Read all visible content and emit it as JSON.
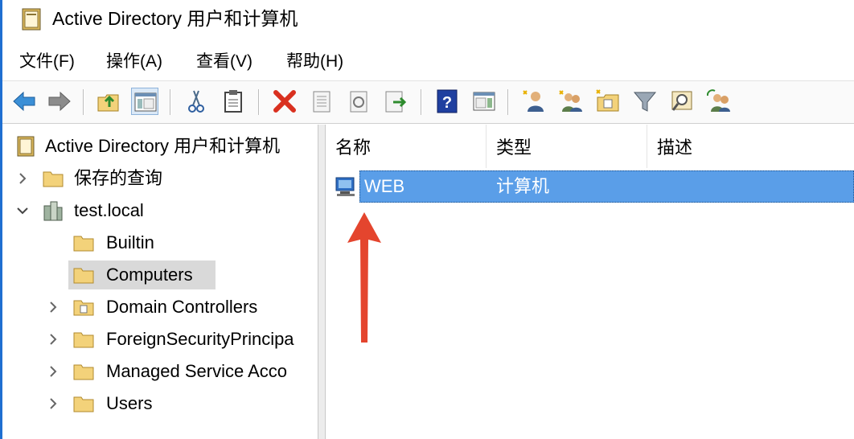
{
  "window": {
    "title": "Active Directory 用户和计算机"
  },
  "menubar": {
    "items": [
      {
        "label": "文件(F)"
      },
      {
        "label": "操作(A)"
      },
      {
        "label": "查看(V)"
      },
      {
        "label": "帮助(H)"
      }
    ]
  },
  "toolbar": {
    "buttons": [
      "back-icon",
      "forward-icon",
      "up-folder-icon",
      "show-hide-tree-icon",
      "cut-icon",
      "paste-icon",
      "delete-icon",
      "properties-icon",
      "refresh-icon",
      "export-list-icon",
      "help-icon",
      "show-hide-action-pane-icon",
      "create-user-icon",
      "create-group-icon",
      "create-ou-icon",
      "filter-icon",
      "find-icon",
      "add-to-group-icon"
    ]
  },
  "tree": {
    "root": {
      "label": "Active Directory 用户和计算机"
    },
    "items": [
      {
        "label": "保存的查询",
        "expanded": false
      },
      {
        "label": "test.local",
        "expanded": true
      },
      {
        "label": "Builtin"
      },
      {
        "label": "Computers",
        "selected": true
      },
      {
        "label": "Domain Controllers"
      },
      {
        "label": "ForeignSecurityPrincipa"
      },
      {
        "label": "Managed Service Acco"
      },
      {
        "label": "Users"
      }
    ]
  },
  "list": {
    "columns": [
      {
        "label": "名称"
      },
      {
        "label": "类型"
      },
      {
        "label": "描述"
      }
    ],
    "rows": [
      {
        "name": "WEB",
        "type": "计算机",
        "description": ""
      }
    ]
  },
  "colors": {
    "selection": "#5a9ee8",
    "tree_selection": "#d9d9d9",
    "annotation_arrow": "#e4452e",
    "folder": "#f3d27a"
  }
}
